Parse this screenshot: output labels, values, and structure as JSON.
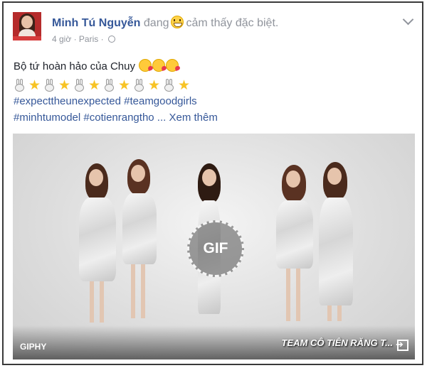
{
  "post": {
    "author": "Minh Tú Nguyễn",
    "activity_prefix": "đang",
    "feeling": "cảm thấy đặc biệt.",
    "time": "4 giờ",
    "location": "Paris",
    "text": "Bộ tứ hoàn hảo của Chuy",
    "emoji_row": [
      "bunny",
      "star",
      "bunny",
      "star",
      "bunny",
      "star",
      "bunny",
      "star",
      "bunny",
      "star",
      "bunny",
      "star"
    ],
    "hashtags_line1": "#expecttheunexpected #teamgoodgirls",
    "hashtags_line2": "#minhtumodel #cotienrangtho ... Xem thêm"
  },
  "gif": {
    "badge": "GIF",
    "provider": "GIPHY",
    "caption": "TEAM CÔ TIÊN RĂNG T..."
  },
  "colors": {
    "link": "#365899",
    "meta": "#90949c",
    "text": "#1d2129",
    "avatar_bg": "#b52b2b"
  },
  "icons": [
    "avatar",
    "grinning-face-emoji",
    "globe-icon",
    "chevron-down-icon",
    "kissing-face-emoji",
    "bunny-emoji",
    "star-emoji",
    "gif-play-icon",
    "expand-icon"
  ]
}
